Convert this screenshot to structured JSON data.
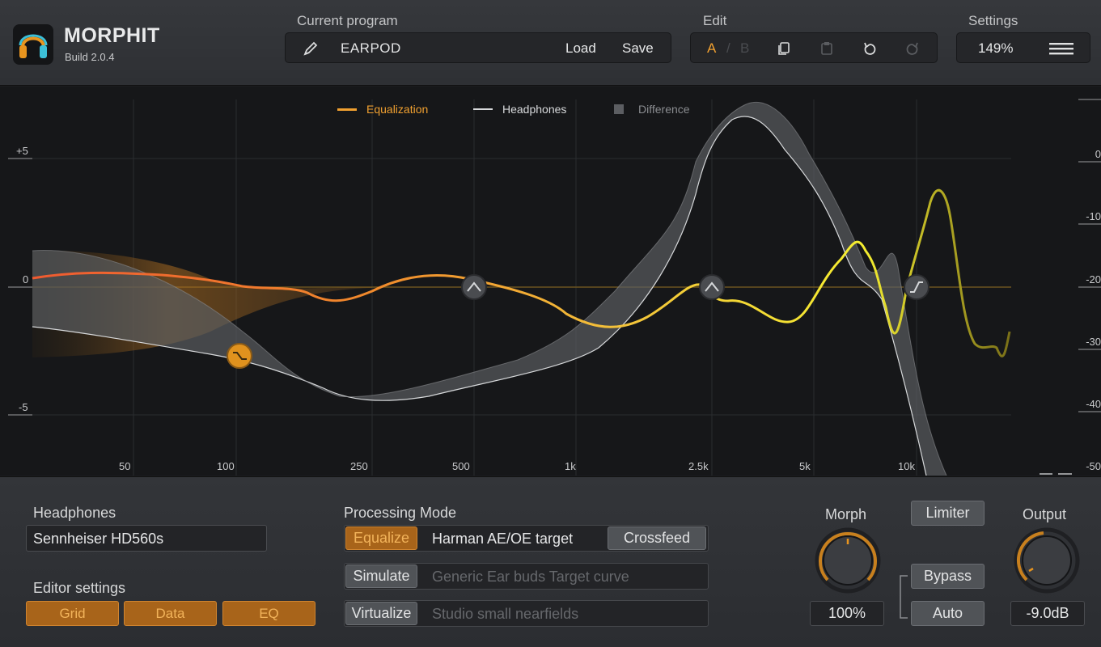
{
  "app": {
    "name": "MORPHIT",
    "build": "Build 2.0.4"
  },
  "header": {
    "program_label": "Current program",
    "program_name": "EARPOD",
    "load_label": "Load",
    "save_label": "Save",
    "edit_label": "Edit",
    "slot_a": "A",
    "slot_sep": "/",
    "slot_b": "B",
    "settings_label": "Settings",
    "zoom": "149%"
  },
  "graph": {
    "legend": [
      {
        "label": "Equalization",
        "color": "#f0a030"
      },
      {
        "label": "Headphones",
        "color": "#d8dadc"
      },
      {
        "label": "Difference",
        "color": "#5c5e62"
      }
    ],
    "db_labels": [
      "+5",
      "0",
      "-5"
    ],
    "freq_labels": [
      "50",
      "100",
      "250",
      "500",
      "1k",
      "2.5k",
      "5k",
      "10k"
    ],
    "right_scale": [
      "0",
      "-10",
      "-20",
      "-30",
      "-40",
      "-50"
    ]
  },
  "panel": {
    "headphones_label": "Headphones",
    "headphones_value": "Sennheiser HD560s",
    "editor_label": "Editor settings",
    "editor_buttons": [
      "Grid",
      "Data",
      "EQ"
    ],
    "mode_label": "Processing Mode",
    "modes": [
      {
        "button": "Equalize",
        "target": "Harman AE/OE target",
        "active": true
      },
      {
        "button": "Simulate",
        "target": "Generic Ear buds Target curve",
        "active": false
      },
      {
        "button": "Virtualize",
        "target": "Studio small nearfields",
        "active": false
      }
    ],
    "crossfeed_label": "Crossfeed",
    "morph_label": "Morph",
    "morph_value": "100%",
    "limiter_label": "Limiter",
    "bypass_label": "Bypass",
    "auto_label": "Auto",
    "output_label": "Output",
    "output_value": "-9.0dB"
  },
  "colors": {
    "accent": "#f0a030",
    "eq_low": "#f05a30",
    "eq_high": "#f5e830"
  }
}
